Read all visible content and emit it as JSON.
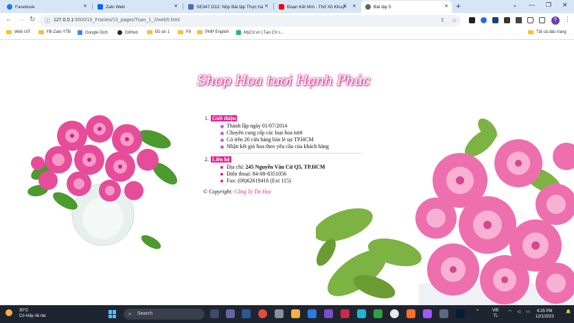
{
  "browser": {
    "tabs": [
      {
        "label": "Facebook",
        "color": "#1877f2",
        "active": false
      },
      {
        "label": "Zalo Web",
        "color": "#0068ff",
        "active": false
      },
      {
        "label": "SE347.O12: Nộp Bài tập Thực hà",
        "color": "#4a6fb5",
        "active": false
      },
      {
        "label": "Đoạn Kết Mới - Thổ Xồ Khu",
        "color": "#ff0000",
        "active": false
      },
      {
        "label": "Bài tập 5",
        "color": "#5f6368",
        "active": true
      }
    ],
    "new_tab": "+",
    "url_host": "127.0.0.1",
    "url_path": ":5500/15_Frames/13_pages/Tuan_1_2/web5.html",
    "profile_letter": "T"
  },
  "bookmarks": {
    "items": [
      {
        "label": "Web UIT",
        "kind": "folder"
      },
      {
        "label": "FB-Zalo-YTB",
        "kind": "folder"
      },
      {
        "label": "Google Dịch",
        "kind": "icon",
        "color": "#4285f4"
      },
      {
        "label": "GitHub",
        "kind": "icon",
        "color": "#24292e"
      },
      {
        "label": "Đồ án 1",
        "kind": "folder"
      },
      {
        "label": "F8",
        "kind": "folder"
      },
      {
        "label": "PMP English",
        "kind": "folder"
      },
      {
        "label": "MyCV.vn | Tạo CV c...",
        "kind": "icon",
        "color": "#2bb673"
      }
    ],
    "all_bookmarks": "Tất cả dấu trang"
  },
  "page": {
    "title": "Shop Hoa tươi Hạnh Phúc",
    "sections": [
      {
        "number": "1.",
        "title": "Giới thiệu",
        "items": [
          "Thành lập ngày 01/07/2014",
          "Chuyên cung cấp các loại hoa tươi",
          "Có trên 20 cửa hàng bán lẻ tại TP.HCM",
          "Nhận kết giỏ hoa theo yêu cầu của khách hàng"
        ]
      },
      {
        "number": "2.",
        "title": "Liên hệ",
        "address_label": "Địa chỉ: ",
        "address_value": "245 Nguyễn Văn Cừ Q5, TP.HCM",
        "phone": "Điện thoại: 84-08-8351056",
        "fax": "Fax: (08)62619416 (Ext 115)"
      }
    ],
    "copyright_label": "© Copyright: ",
    "copyright_company": "Công Ty Tin Học",
    "colors": {
      "accent": "#e5208e",
      "bullet": "#b467d2"
    }
  },
  "taskbar": {
    "temperature": "30°C",
    "weather": "Có mây rải rác",
    "search_placeholder": "Search",
    "lang_top": "VIE",
    "lang_bottom": "TL",
    "time": "6:25 PM",
    "date": "12/1/2023"
  }
}
